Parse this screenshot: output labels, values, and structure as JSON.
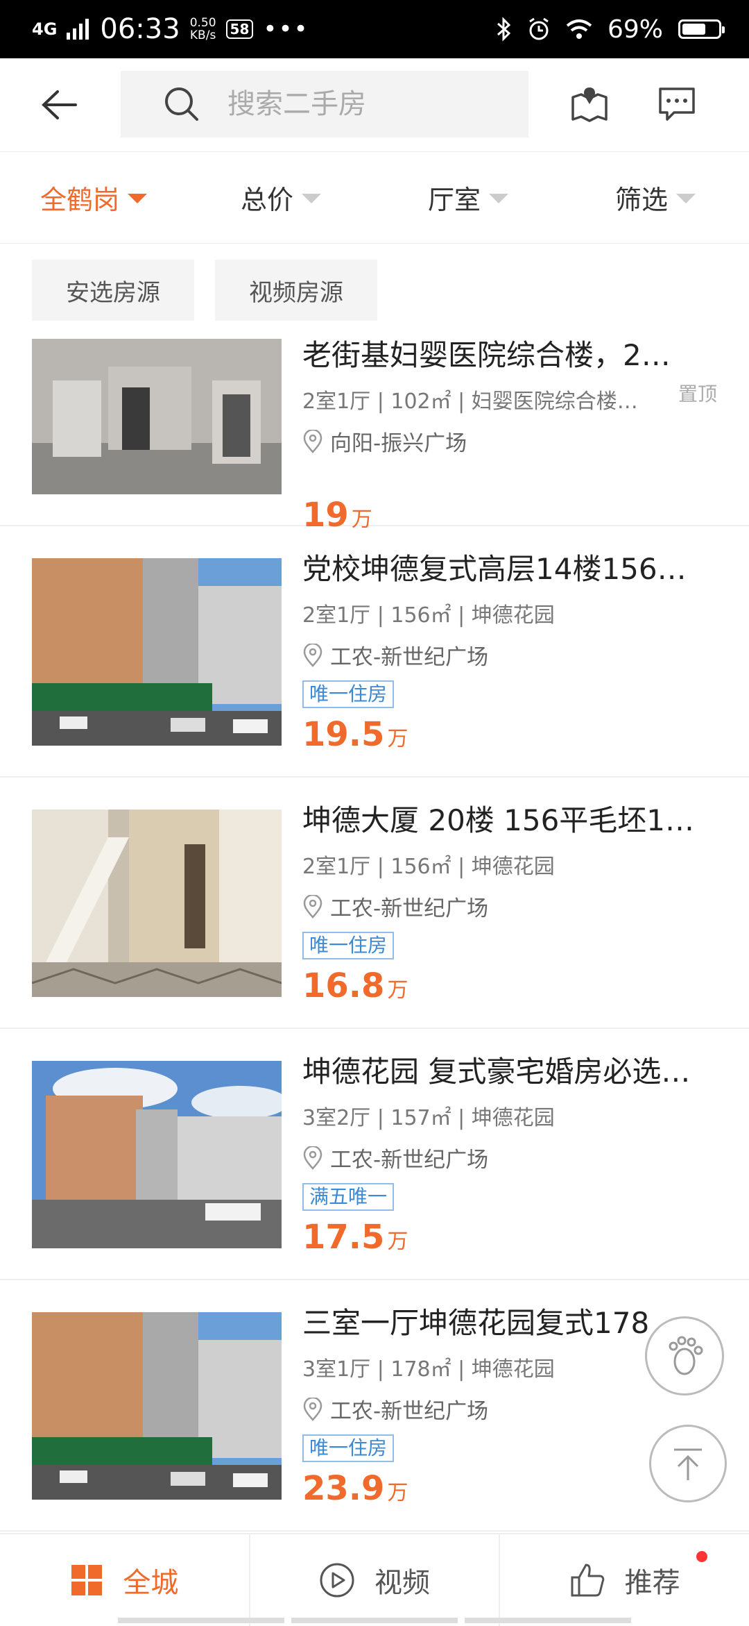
{
  "status_bar": {
    "network": "4G",
    "time": "06:33",
    "speed_value": "0.50",
    "speed_unit": "KB/s",
    "app_badge": "58",
    "more": "•••",
    "battery_text": "69%",
    "battery_level": 0.69
  },
  "header": {
    "search_placeholder": "搜索二手房"
  },
  "filters": [
    {
      "label": "全鹤岗",
      "active": true
    },
    {
      "label": "总价",
      "active": false
    },
    {
      "label": "厅室",
      "active": false
    },
    {
      "label": "筛选",
      "active": false
    }
  ],
  "chips": [
    "安选房源",
    "视频房源"
  ],
  "listings": [
    {
      "title": "老街基妇婴医院综合楼，2…",
      "meta": "2室1厅 | 102㎡ | 妇婴医院综合楼…",
      "location": "向阳-振兴广场",
      "tag": "",
      "price": "19",
      "unit": "万",
      "pinned": "置顶"
    },
    {
      "title": "党校坤德复式高层14楼156…",
      "meta": "2室1厅 | 156㎡ | 坤德花园",
      "location": "工农-新世纪广场",
      "tag": "唯一住房",
      "price": "19.5",
      "unit": "万",
      "pinned": ""
    },
    {
      "title": "坤德大厦 20楼 156平毛坯1…",
      "meta": "2室1厅 | 156㎡ | 坤德花园",
      "location": "工农-新世纪广场",
      "tag": "唯一住房",
      "price": "16.8",
      "unit": "万",
      "pinned": ""
    },
    {
      "title": "坤德花园 复式豪宅婚房必选…",
      "meta": "3室2厅 | 157㎡ | 坤德花园",
      "location": "工农-新世纪广场",
      "tag": "满五唯一",
      "price": "17.5",
      "unit": "万",
      "pinned": ""
    },
    {
      "title": "三室一厅坤德花园复式178",
      "meta": "3室1厅 | 178㎡ | 坤德花园",
      "location": "工农-新世纪广场",
      "tag": "唯一住房",
      "price": "23.9",
      "unit": "万",
      "pinned": ""
    }
  ],
  "tabbar": [
    {
      "label": "全城",
      "icon": "grid-icon",
      "active": true
    },
    {
      "label": "视频",
      "icon": "play-icon",
      "active": false
    },
    {
      "label": "推荐",
      "icon": "thumbs-up-icon",
      "active": false
    }
  ],
  "colors": {
    "accent": "#f06a2b",
    "tag_blue": "#3a8ad6"
  }
}
